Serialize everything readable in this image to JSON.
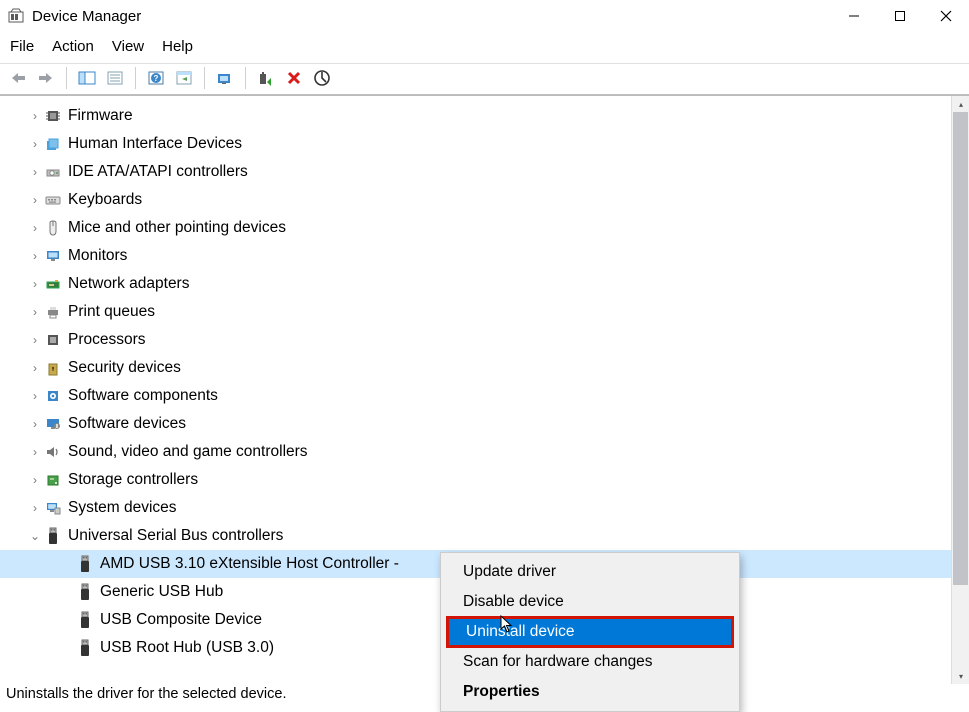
{
  "title": "Device Manager",
  "menus": {
    "file": "File",
    "action": "Action",
    "view": "View",
    "help": "Help"
  },
  "tree": {
    "items": [
      {
        "label": "Firmware",
        "icon": "chip"
      },
      {
        "label": "Human Interface Devices",
        "icon": "hid"
      },
      {
        "label": "IDE ATA/ATAPI controllers",
        "icon": "ide"
      },
      {
        "label": "Keyboards",
        "icon": "keyboard"
      },
      {
        "label": "Mice and other pointing devices",
        "icon": "mouse"
      },
      {
        "label": "Monitors",
        "icon": "monitor"
      },
      {
        "label": "Network adapters",
        "icon": "network"
      },
      {
        "label": "Print queues",
        "icon": "printer"
      },
      {
        "label": "Processors",
        "icon": "cpu"
      },
      {
        "label": "Security devices",
        "icon": "security"
      },
      {
        "label": "Software components",
        "icon": "component"
      },
      {
        "label": "Software devices",
        "icon": "softdev"
      },
      {
        "label": "Sound, video and game controllers",
        "icon": "sound"
      },
      {
        "label": "Storage controllers",
        "icon": "storage"
      },
      {
        "label": "System devices",
        "icon": "system"
      },
      {
        "label": "Universal Serial Bus controllers",
        "icon": "usb",
        "expanded": true,
        "children": [
          {
            "label": "AMD USB 3.10 eXtensible Host Controller -",
            "icon": "usb",
            "selected": true
          },
          {
            "label": "Generic USB Hub",
            "icon": "usb"
          },
          {
            "label": "USB Composite Device",
            "icon": "usb"
          },
          {
            "label": "USB Root Hub (USB 3.0)",
            "icon": "usb"
          }
        ]
      }
    ]
  },
  "context_menu": {
    "items": [
      {
        "label": "Update driver"
      },
      {
        "label": "Disable device"
      },
      {
        "label": "Uninstall device",
        "highlight": true
      },
      {
        "label": "Scan for hardware changes"
      },
      {
        "label": "Properties",
        "bold": true
      }
    ]
  },
  "status": "Uninstalls the driver for the selected device."
}
